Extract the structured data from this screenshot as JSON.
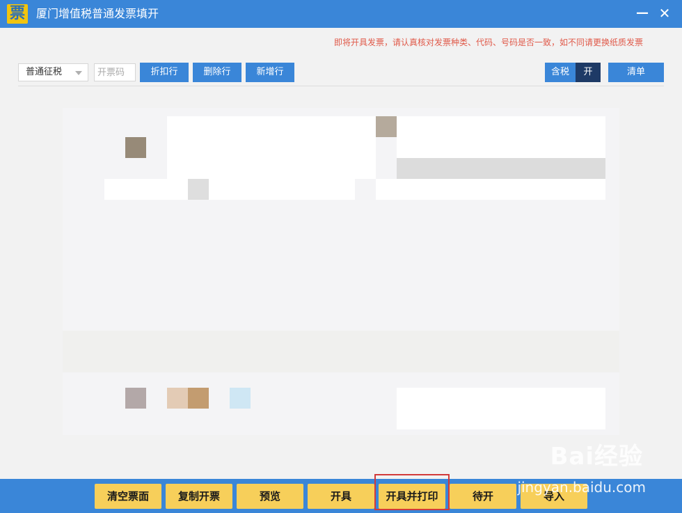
{
  "window": {
    "app_icon_glyph": "票",
    "title": "厦门增值税普通发票填开",
    "minimize_glyph": "—",
    "close_glyph": "✕"
  },
  "notice": "即将开具发票，请认真核对发票种类、代码、号码是否一致，如不同请更换纸质发票",
  "toolbar": {
    "tax_mode_value": "普通征税",
    "invoice_code_placeholder": "开票码",
    "discount_row_label": "折扣行",
    "delete_row_label": "删除行",
    "add_row_label": "新增行",
    "tax_included_label": "含税",
    "tax_included_state": "开",
    "list_label": "清单"
  },
  "bottom_actions": {
    "clear_label": "清空票面",
    "copy_label": "复制开票",
    "preview_label": "预览",
    "issue_label": "开具",
    "issue_print_label": "开具并打印",
    "pending_label": "待开",
    "import_label": "导入"
  },
  "watermark": {
    "brand": "Bai经验",
    "url": "jingyan.baidu.com"
  },
  "colors": {
    "accent": "#3a86d8",
    "action_button": "#f7cf5a",
    "highlight": "#d23a3a",
    "notice": "#e05a4a"
  }
}
